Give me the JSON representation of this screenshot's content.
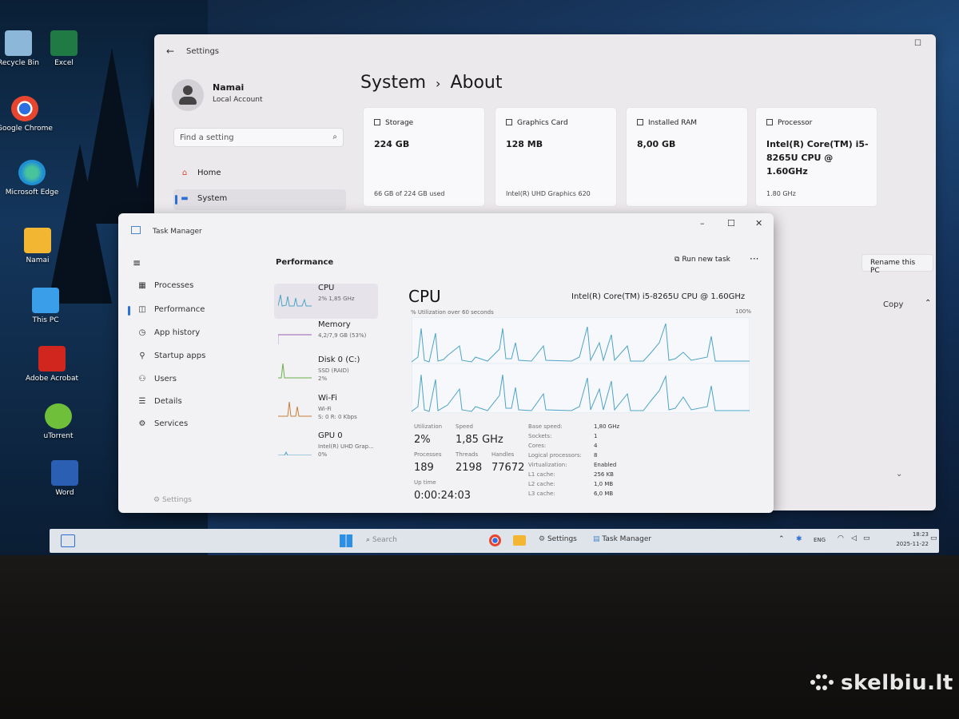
{
  "desktop": {
    "icons": [
      {
        "label": "Recycle Bin",
        "icon": "recycle-bin-icon",
        "color": "#8db7d8"
      },
      {
        "label": "Excel",
        "icon": "excel-icon",
        "color": "#1f7a43"
      },
      {
        "label": "Google Chrome",
        "icon": "chrome-icon",
        "color": "#e6452f"
      },
      {
        "label": "Microsoft Edge",
        "icon": "edge-icon",
        "color": "#1f8fd4"
      },
      {
        "label": "Namai",
        "icon": "folder-icon",
        "color": "#f2b632"
      },
      {
        "label": "This PC",
        "icon": "monitor-icon",
        "color": "#3a9ee8"
      },
      {
        "label": "Adobe Acrobat",
        "icon": "acrobat-icon",
        "color": "#d0261e"
      },
      {
        "label": "uTorrent",
        "icon": "utorrent-icon",
        "color": "#6fbf3a"
      },
      {
        "label": "Word",
        "icon": "word-icon",
        "color": "#2b5fb3"
      }
    ]
  },
  "settings": {
    "title": "Settings",
    "user": {
      "name": "Namai",
      "type": "Local Account"
    },
    "search_placeholder": "Find a setting",
    "nav": [
      {
        "label": "Home",
        "icon": "home-icon"
      },
      {
        "label": "System",
        "icon": "system-icon"
      }
    ],
    "breadcrumb": {
      "parent": "System",
      "separator": "›",
      "current": "About"
    },
    "cards": [
      {
        "label": "Storage",
        "value": "224 GB",
        "sub": "66 GB of 224 GB used",
        "icon": "storage-icon"
      },
      {
        "label": "Graphics Card",
        "value": "128 MB",
        "sub": "Intel(R) UHD Graphics 620",
        "icon": "graphics-card-icon"
      },
      {
        "label": "Installed RAM",
        "value": "8,00 GB",
        "sub": "",
        "icon": "ram-icon"
      },
      {
        "label": "Processor",
        "value": "Intel(R) Core(TM) i5-8265U CPU @ 1.60GHz",
        "sub": "1.80 GHz",
        "icon": "processor-icon"
      }
    ],
    "rename_button": "Rename this PC",
    "copy_button": "Copy"
  },
  "task_manager": {
    "title": "Task Manager",
    "nav": [
      {
        "label": "Processes",
        "icon": "processes-icon"
      },
      {
        "label": "Performance",
        "icon": "performance-icon"
      },
      {
        "label": "App history",
        "icon": "app-history-icon"
      },
      {
        "label": "Startup apps",
        "icon": "startup-icon"
      },
      {
        "label": "Users",
        "icon": "users-icon"
      },
      {
        "label": "Details",
        "icon": "details-icon"
      },
      {
        "label": "Services",
        "icon": "services-icon"
      }
    ],
    "settings_label": "Settings",
    "page_title": "Performance",
    "run_task": "Run new task",
    "resources": [
      {
        "name": "CPU",
        "sub": "2% 1,85 GHz"
      },
      {
        "name": "Memory",
        "sub": "4,2/7,9 GB (53%)"
      },
      {
        "name": "Disk 0 (C:)",
        "sub": "SSD (RAID)\n2%"
      },
      {
        "name": "Wi-Fi",
        "sub": "Wi-Fi\nS: 0 R: 0 Kbps"
      },
      {
        "name": "GPU 0",
        "sub": "Intel(R) UHD Grap...\n0%"
      }
    ],
    "cpu": {
      "heading": "CPU",
      "model": "Intel(R) Core(TM) i5-8265U CPU @ 1.60GHz",
      "util_label": "% Utilization over 60 seconds",
      "max_label": "100%",
      "stats": {
        "utilization_label": "Utilization",
        "utilization": "2%",
        "speed_label": "Speed",
        "speed": "1,85 GHz",
        "processes_label": "Processes",
        "processes": "189",
        "threads_label": "Threads",
        "threads": "2198",
        "handles_label": "Handles",
        "handles": "77672",
        "uptime_label": "Up time",
        "uptime": "0:00:24:03"
      },
      "details": [
        {
          "k": "Base speed:",
          "v": "1,80 GHz"
        },
        {
          "k": "Sockets:",
          "v": "1"
        },
        {
          "k": "Cores:",
          "v": "4"
        },
        {
          "k": "Logical processors:",
          "v": "8"
        },
        {
          "k": "Virtualization:",
          "v": "Enabled"
        },
        {
          "k": "L1 cache:",
          "v": "256 KB"
        },
        {
          "k": "L2 cache:",
          "v": "1,0 MB"
        },
        {
          "k": "L3 cache:",
          "v": "6,0 MB"
        }
      ]
    }
  },
  "taskbar": {
    "search_placeholder": "Search",
    "apps": [
      "Settings",
      "Task Manager"
    ],
    "lang": "ENG",
    "time": "18:23",
    "date": "2025-11-22"
  },
  "watermark": "skelbiu.lt",
  "colors": {
    "accent": "#2c6fd6",
    "graph_line": "#4da3c7"
  }
}
